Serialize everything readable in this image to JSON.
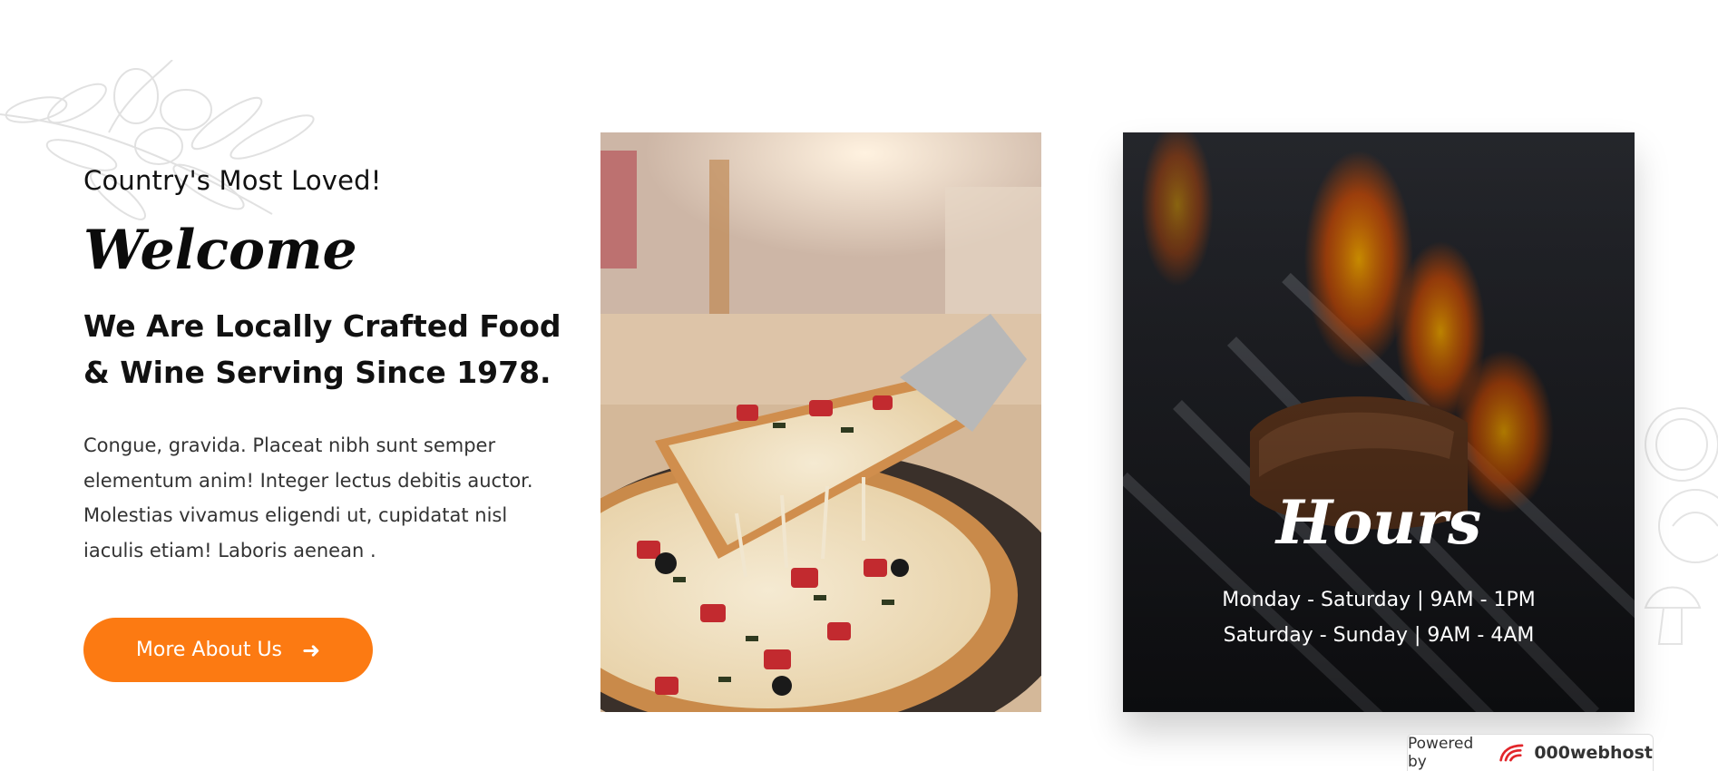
{
  "intro": {
    "kicker": "Country's Most Loved!",
    "heading": "Welcome",
    "subheading": "We Are Locally Crafted Food & Wine Serving Since 1978.",
    "body": "Congue, gravida. Placeat nibh sunt semper elementum anim! Integer lectus debitis auctor. Molestias vivamus eligendi ut, cupidatat nisl iaculis etiam! Laboris aenean .",
    "cta_label": "More About Us",
    "cta_icon": "arrow-right-icon"
  },
  "hours": {
    "title": "Hours",
    "lines": [
      "Monday - Saturday | 9AM - 1PM",
      "Saturday - Sunday | 9AM - 4AM"
    ]
  },
  "footer_badge": {
    "prefix": "Powered by",
    "brand": "000webhost",
    "icon": "000webhost-logo-icon"
  },
  "colors": {
    "accent": "#fc7a12",
    "text_dark": "#111111",
    "text_body": "#333333"
  }
}
